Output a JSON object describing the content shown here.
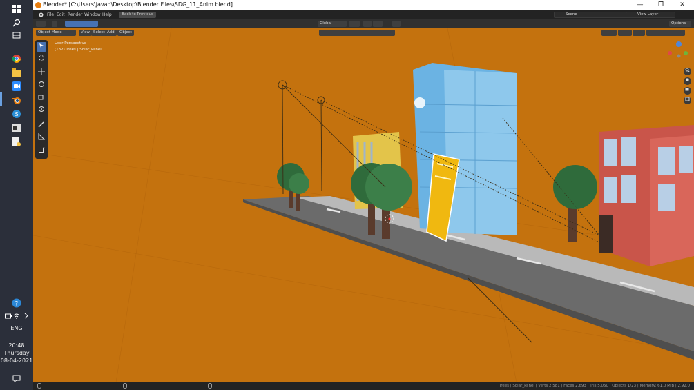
{
  "window": {
    "title": "Blender* [C:\\Users\\javad\\Desktop\\Blender Files\\SDG_11_Anim.blend]",
    "minimize": "—",
    "maximize": "❐",
    "close": "✕"
  },
  "menus": [
    "File",
    "Edit",
    "Render",
    "Window",
    "Help"
  ],
  "topbar": {
    "back_label": "Back to Previous",
    "scene_label": "Scene",
    "view_layer_label": "View Layer"
  },
  "header": {
    "mode_label": "Object Mode",
    "view_menus": [
      "View",
      "Select",
      "Add",
      "Object"
    ],
    "transform_orientation": "Global",
    "options_label": "Options"
  },
  "viewport": {
    "view_name": "User Perspective",
    "active_info": "(132) Trees | Solar_Panel",
    "background_color": "#c4720e"
  },
  "status": {
    "text": "Trees | Solar_Panel | Verts 2,581 | Faces 2,693 | Tris 5,050 | Objects 1/23 | Memory: 61.0 MiB | 2.92.0"
  },
  "taskbar": {
    "lang": "ENG",
    "time": "20:48",
    "day": "Thursday",
    "date": "08-04-2021"
  }
}
